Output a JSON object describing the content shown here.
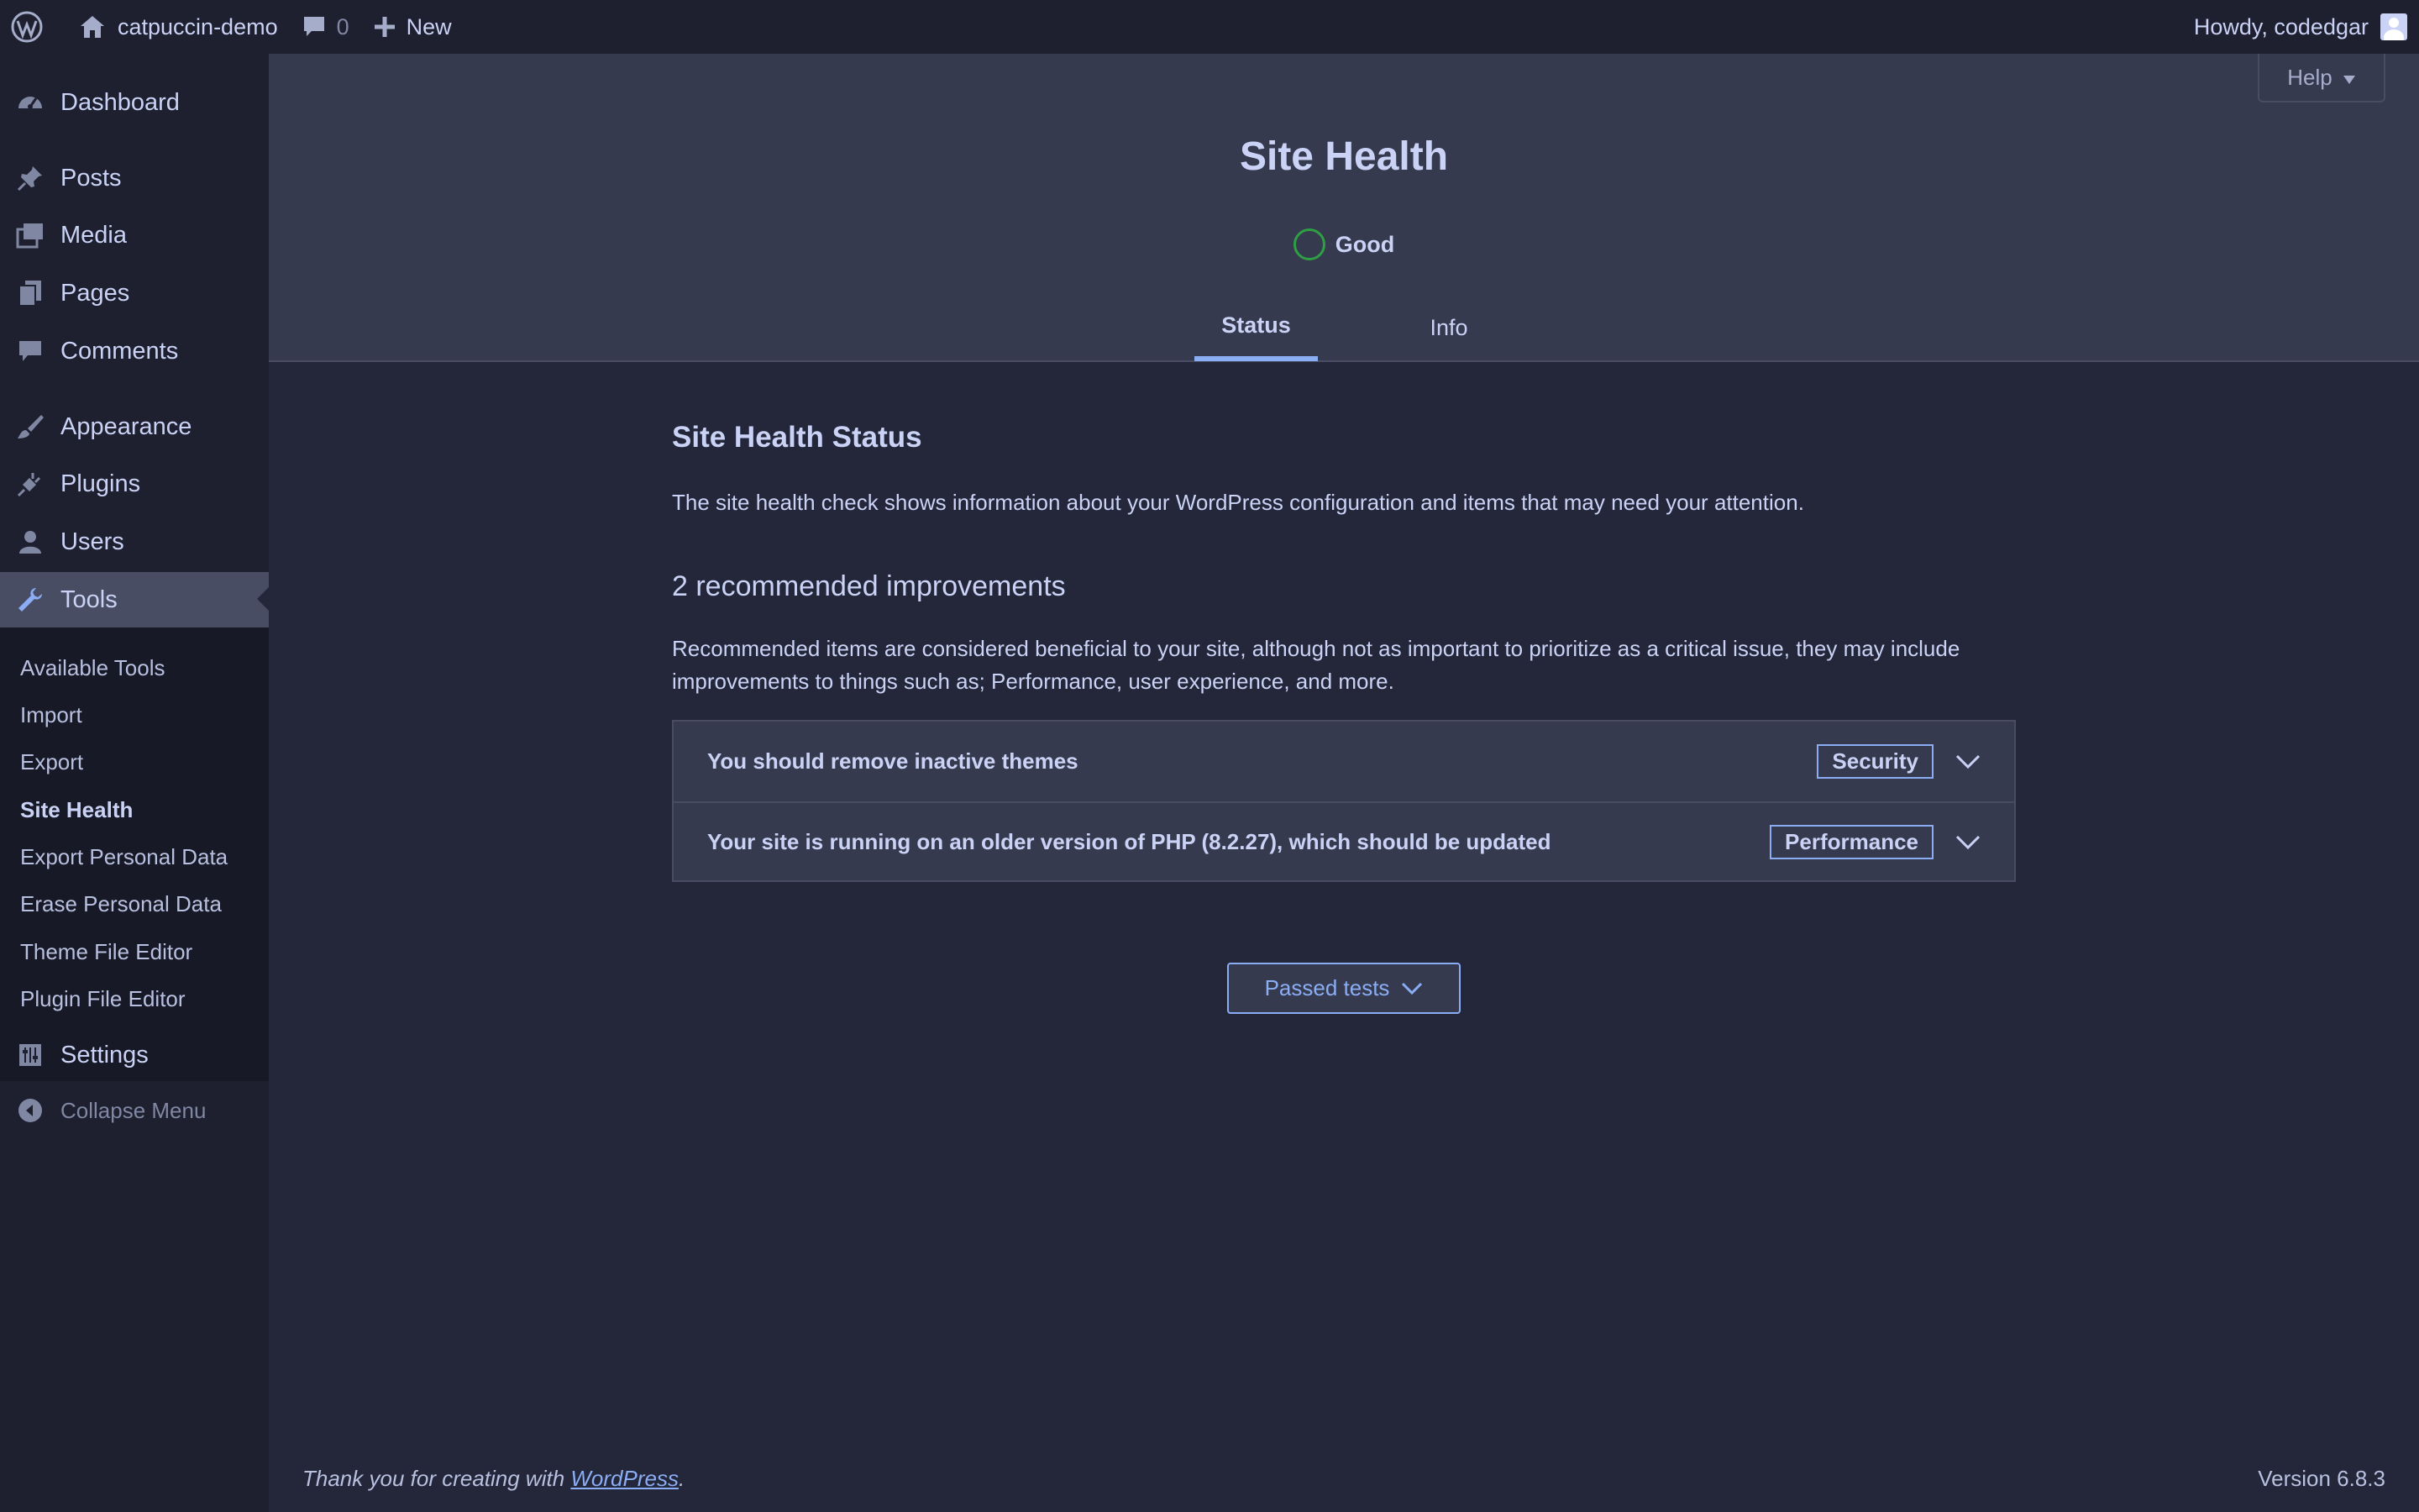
{
  "adminbar": {
    "site_name": "catpuccin-demo",
    "comments_count": "0",
    "new_label": "New",
    "greeting": "Howdy, codedgar"
  },
  "sidebar": {
    "items": [
      {
        "label": "Dashboard",
        "icon": "dashboard-icon"
      },
      {
        "label": "Posts",
        "icon": "pin-icon"
      },
      {
        "label": "Media",
        "icon": "media-icon"
      },
      {
        "label": "Pages",
        "icon": "pages-icon"
      },
      {
        "label": "Comments",
        "icon": "comment-icon"
      },
      {
        "label": "Appearance",
        "icon": "brush-icon"
      },
      {
        "label": "Plugins",
        "icon": "plug-icon"
      },
      {
        "label": "Users",
        "icon": "user-icon"
      },
      {
        "label": "Tools",
        "icon": "wrench-icon"
      },
      {
        "label": "Settings",
        "icon": "settings-icon"
      }
    ],
    "submenu": [
      "Available Tools",
      "Import",
      "Export",
      "Site Health",
      "Export Personal Data",
      "Erase Personal Data",
      "Theme File Editor",
      "Plugin File Editor"
    ],
    "collapse_label": "Collapse Menu"
  },
  "header": {
    "help_label": "Help",
    "title": "Site Health",
    "status": "Good",
    "tabs": [
      "Status",
      "Info"
    ]
  },
  "main": {
    "heading": "Site Health Status",
    "intro": "The site health check shows information about your WordPress configuration and items that may need your attention.",
    "improvements_heading": "2 recommended improvements",
    "improvements_desc": "Recommended items are considered beneficial to your site, although not as important to prioritize as a critical issue, they may include improvements to things such as; Performance, user experience, and more.",
    "issues": [
      {
        "title": "You should remove inactive themes",
        "badge": "Security"
      },
      {
        "title": "Your site is running on an older version of PHP (8.2.27), which should be updated",
        "badge": "Performance"
      }
    ],
    "passed_tests_label": "Passed tests"
  },
  "footer": {
    "thanks": "Thank you for creating with ",
    "link": "WordPress",
    "period": ".",
    "version": "Version 6.8.3"
  },
  "colors": {
    "accent": "#8aadf4",
    "status_good": "#2ea043",
    "background": "#24273a"
  }
}
